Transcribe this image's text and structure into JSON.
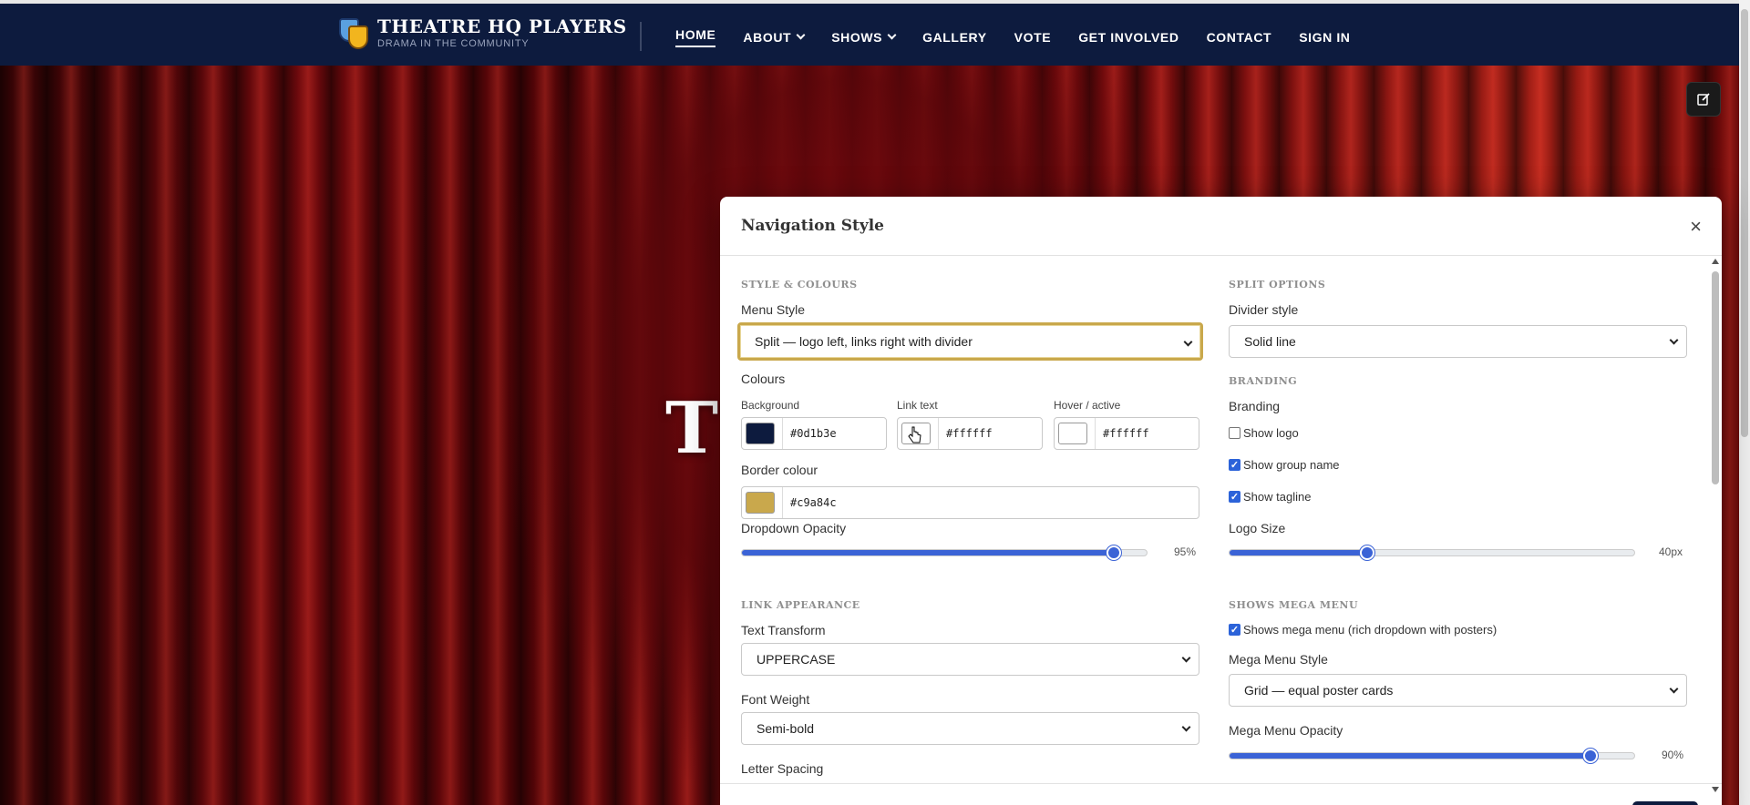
{
  "site": {
    "name": "THEATRE HQ PLAYERS",
    "tagline": "DRAMA IN THE COMMUNITY",
    "hero_title_visible": "T"
  },
  "nav": {
    "items": [
      {
        "label": "HOME",
        "active": true,
        "dropdown": false
      },
      {
        "label": "ABOUT",
        "active": false,
        "dropdown": true
      },
      {
        "label": "SHOWS",
        "active": false,
        "dropdown": true
      },
      {
        "label": "GALLERY",
        "active": false,
        "dropdown": false
      },
      {
        "label": "VOTE",
        "active": false,
        "dropdown": false
      },
      {
        "label": "GET INVOLVED",
        "active": false,
        "dropdown": false
      },
      {
        "label": "CONTACT",
        "active": false,
        "dropdown": false
      },
      {
        "label": "SIGN IN",
        "active": false,
        "dropdown": false
      }
    ]
  },
  "modal": {
    "title": "Navigation Style",
    "close_glyph": "×",
    "left": {
      "section_style": "STYLE & COLOURS",
      "menu_style_label": "Menu Style",
      "menu_style_value": "Split — logo left, links right with divider",
      "colours_label": "Colours",
      "background_label": "Background",
      "background_value": "#0d1b3e",
      "link_text_label": "Link text",
      "link_text_value": "#ffffff",
      "hover_label": "Hover / active",
      "hover_value": "#ffffff",
      "border_label": "Border colour",
      "border_value": "#c9a84c",
      "dropdown_opacity_label": "Dropdown Opacity",
      "dropdown_opacity_value": "95%",
      "dropdown_opacity_fraction": 0.95,
      "section_link": "LINK APPEARANCE",
      "text_transform_label": "Text Transform",
      "text_transform_value": "UPPERCASE",
      "font_weight_label": "Font Weight",
      "font_weight_value": "Semi-bold",
      "letter_spacing_label": "Letter Spacing"
    },
    "right": {
      "section_split": "SPLIT OPTIONS",
      "divider_label": "Divider style",
      "divider_value": "Solid line",
      "section_branding": "BRANDING",
      "branding_label": "Branding",
      "show_logo": {
        "label": "Show logo",
        "checked": false
      },
      "show_group_name": {
        "label": "Show group name",
        "checked": true
      },
      "show_tagline": {
        "label": "Show tagline",
        "checked": true
      },
      "logo_size_label": "Logo Size",
      "logo_size_value": "40px",
      "logo_size_fraction": 0.34,
      "section_mega": "SHOWS MEGA MENU",
      "mega_enable": {
        "label": "Shows mega menu (rich dropdown with posters)",
        "checked": true
      },
      "mega_style_label": "Mega Menu Style",
      "mega_style_value": "Grid — equal poster cards",
      "mega_opacity_label": "Mega Menu Opacity",
      "mega_opacity_value": "90%",
      "mega_opacity_fraction": 0.9
    }
  },
  "colors": {
    "nav_bg": "#0d1b3e",
    "accent": "#c9a84c",
    "slider": "#3b63d6"
  }
}
